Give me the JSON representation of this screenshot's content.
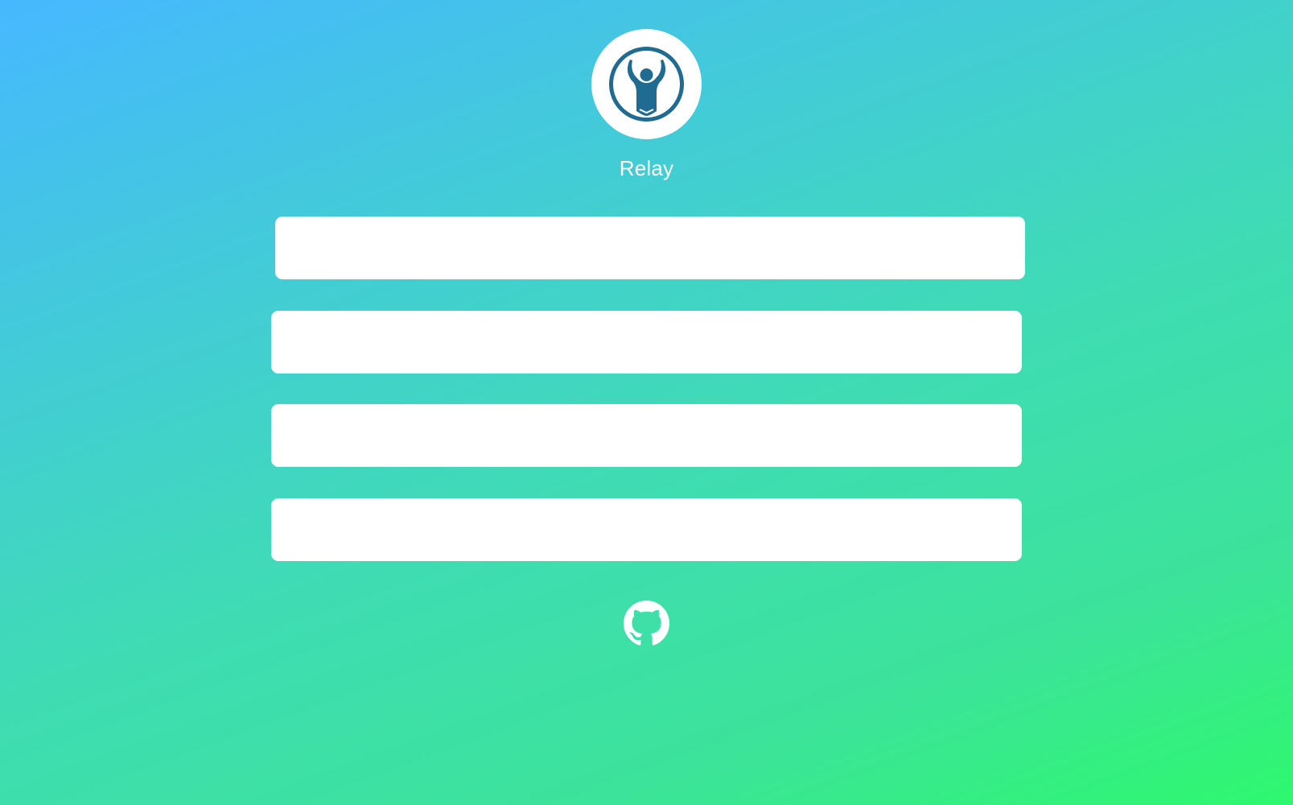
{
  "app": {
    "name": "Relay",
    "logo_icon": "person-arms-raised-ring-icon",
    "logo_color": "#1f6b91"
  },
  "form": {
    "fields": [
      {
        "value": "",
        "placeholder": ""
      },
      {
        "value": "",
        "placeholder": ""
      },
      {
        "value": "",
        "placeholder": ""
      },
      {
        "value": "",
        "placeholder": ""
      }
    ]
  },
  "footer": {
    "github_icon": "github-icon"
  },
  "colors": {
    "gradient_start": "#46b8ff",
    "gradient_end": "#2ef86e",
    "field_background": "#ffffff",
    "text": "#ffffff"
  }
}
